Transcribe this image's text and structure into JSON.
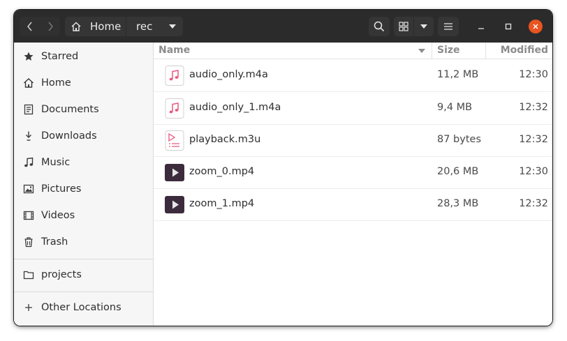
{
  "header": {
    "path": [
      {
        "label": "Home",
        "icon": "home-icon"
      },
      {
        "label": "rec"
      }
    ]
  },
  "sidebar": {
    "items": [
      {
        "label": "Starred",
        "icon": "star-icon"
      },
      {
        "label": "Home",
        "icon": "home-icon"
      },
      {
        "label": "Documents",
        "icon": "document-icon"
      },
      {
        "label": "Downloads",
        "icon": "download-icon"
      },
      {
        "label": "Music",
        "icon": "music-icon"
      },
      {
        "label": "Pictures",
        "icon": "picture-icon"
      },
      {
        "label": "Videos",
        "icon": "video-icon"
      },
      {
        "label": "Trash",
        "icon": "trash-icon"
      }
    ],
    "bookmarks": [
      {
        "label": "projects",
        "icon": "folder-icon"
      }
    ],
    "other": {
      "label": "Other Locations",
      "icon": "plus-icon"
    }
  },
  "columns": {
    "name": "Name",
    "size": "Size",
    "modified": "Modified"
  },
  "files": [
    {
      "name": "audio_only.m4a",
      "size": "11,2 MB",
      "modified": "12:30",
      "type": "audio"
    },
    {
      "name": "audio_only_1.m4a",
      "size": "9,4 MB",
      "modified": "12:32",
      "type": "audio"
    },
    {
      "name": "playback.m3u",
      "size": "87 bytes",
      "modified": "12:32",
      "type": "playlist"
    },
    {
      "name": "zoom_0.mp4",
      "size": "20,6 MB",
      "modified": "12:30",
      "type": "video"
    },
    {
      "name": "zoom_1.mp4",
      "size": "28,3 MB",
      "modified": "12:32",
      "type": "video"
    }
  ],
  "colors": {
    "headerbar": "#2b2b2b",
    "close_button": "#e95420",
    "audio_icon": "#e8577e",
    "video_icon": "#3c2b3d"
  }
}
